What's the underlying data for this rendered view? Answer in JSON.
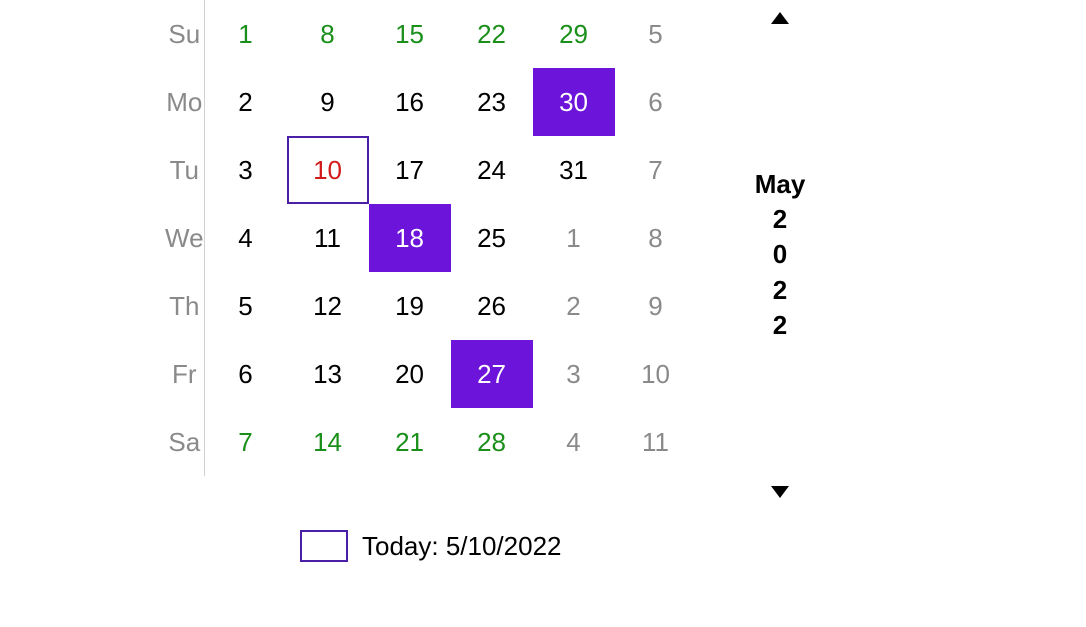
{
  "day_labels": [
    "Su",
    "Mo",
    "Tu",
    "We",
    "Th",
    "Fr",
    "Sa"
  ],
  "month_label": "May",
  "year_chars": [
    "2",
    "0",
    "2",
    "2"
  ],
  "today_label": "Today: 5/10/2022",
  "columns": [
    [
      {
        "d": 1,
        "weekend": true,
        "other": false,
        "sel": false,
        "today": false
      },
      {
        "d": 2,
        "weekend": false,
        "other": false,
        "sel": false,
        "today": false
      },
      {
        "d": 3,
        "weekend": false,
        "other": false,
        "sel": false,
        "today": false
      },
      {
        "d": 4,
        "weekend": false,
        "other": false,
        "sel": false,
        "today": false
      },
      {
        "d": 5,
        "weekend": false,
        "other": false,
        "sel": false,
        "today": false
      },
      {
        "d": 6,
        "weekend": false,
        "other": false,
        "sel": false,
        "today": false
      },
      {
        "d": 7,
        "weekend": true,
        "other": false,
        "sel": false,
        "today": false
      }
    ],
    [
      {
        "d": 8,
        "weekend": true,
        "other": false,
        "sel": false,
        "today": false
      },
      {
        "d": 9,
        "weekend": false,
        "other": false,
        "sel": false,
        "today": false
      },
      {
        "d": 10,
        "weekend": false,
        "other": false,
        "sel": false,
        "today": true
      },
      {
        "d": 11,
        "weekend": false,
        "other": false,
        "sel": false,
        "today": false
      },
      {
        "d": 12,
        "weekend": false,
        "other": false,
        "sel": false,
        "today": false
      },
      {
        "d": 13,
        "weekend": false,
        "other": false,
        "sel": false,
        "today": false
      },
      {
        "d": 14,
        "weekend": true,
        "other": false,
        "sel": false,
        "today": false
      }
    ],
    [
      {
        "d": 15,
        "weekend": true,
        "other": false,
        "sel": false,
        "today": false
      },
      {
        "d": 16,
        "weekend": false,
        "other": false,
        "sel": false,
        "today": false
      },
      {
        "d": 17,
        "weekend": false,
        "other": false,
        "sel": false,
        "today": false
      },
      {
        "d": 18,
        "weekend": false,
        "other": false,
        "sel": true,
        "today": false
      },
      {
        "d": 19,
        "weekend": false,
        "other": false,
        "sel": false,
        "today": false
      },
      {
        "d": 20,
        "weekend": false,
        "other": false,
        "sel": false,
        "today": false
      },
      {
        "d": 21,
        "weekend": true,
        "other": false,
        "sel": false,
        "today": false
      }
    ],
    [
      {
        "d": 22,
        "weekend": true,
        "other": false,
        "sel": false,
        "today": false
      },
      {
        "d": 23,
        "weekend": false,
        "other": false,
        "sel": false,
        "today": false
      },
      {
        "d": 24,
        "weekend": false,
        "other": false,
        "sel": false,
        "today": false
      },
      {
        "d": 25,
        "weekend": false,
        "other": false,
        "sel": false,
        "today": false
      },
      {
        "d": 26,
        "weekend": false,
        "other": false,
        "sel": false,
        "today": false
      },
      {
        "d": 27,
        "weekend": false,
        "other": false,
        "sel": true,
        "today": false
      },
      {
        "d": 28,
        "weekend": true,
        "other": false,
        "sel": false,
        "today": false
      }
    ],
    [
      {
        "d": 29,
        "weekend": true,
        "other": false,
        "sel": false,
        "today": false
      },
      {
        "d": 30,
        "weekend": false,
        "other": false,
        "sel": true,
        "today": false
      },
      {
        "d": 31,
        "weekend": false,
        "other": false,
        "sel": false,
        "today": false
      },
      {
        "d": 1,
        "weekend": false,
        "other": true,
        "sel": false,
        "today": false
      },
      {
        "d": 2,
        "weekend": false,
        "other": true,
        "sel": false,
        "today": false
      },
      {
        "d": 3,
        "weekend": false,
        "other": true,
        "sel": false,
        "today": false
      },
      {
        "d": 4,
        "weekend": true,
        "other": true,
        "sel": false,
        "today": false
      }
    ],
    [
      {
        "d": 5,
        "weekend": true,
        "other": true,
        "sel": false,
        "today": false
      },
      {
        "d": 6,
        "weekend": false,
        "other": true,
        "sel": false,
        "today": false
      },
      {
        "d": 7,
        "weekend": false,
        "other": true,
        "sel": false,
        "today": false
      },
      {
        "d": 8,
        "weekend": false,
        "other": true,
        "sel": false,
        "today": false
      },
      {
        "d": 9,
        "weekend": false,
        "other": true,
        "sel": false,
        "today": false
      },
      {
        "d": 10,
        "weekend": false,
        "other": true,
        "sel": false,
        "today": false
      },
      {
        "d": 11,
        "weekend": true,
        "other": true,
        "sel": false,
        "today": false
      }
    ]
  ]
}
